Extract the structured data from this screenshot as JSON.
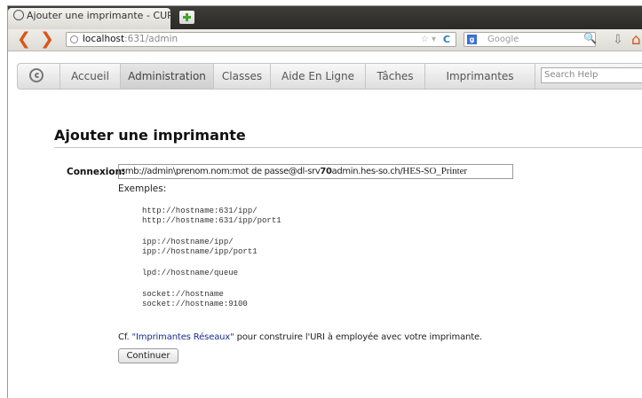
{
  "browser": {
    "tab_title": "Ajouter une imprimante - CUP...",
    "url_host": "localhost",
    "url_rest": ":631/admin",
    "search_engine_placeholder": "Google",
    "icons": [
      "back-arrow-icon",
      "forward-arrow-icon",
      "globe-icon",
      "bookmark-star-icon",
      "reload-icon",
      "google-icon",
      "magnifier-icon",
      "download-icon",
      "home-icon",
      "new-tab-icon"
    ]
  },
  "cups_menu": {
    "items": [
      "Accueil",
      "Administration",
      "Classes",
      "Aide En Ligne",
      "Tâches",
      "Imprimantes"
    ],
    "active": "Administration",
    "search_placeholder": "Search Help"
  },
  "page": {
    "title": "Ajouter une imprimante",
    "connection_label": "Connexion:",
    "connection_value_part1": "smb://admin\\prenom.nom:mot de passe@dl-srv",
    "connection_value_bold": "70",
    "connection_value_part2": "admin.hes-so.ch/",
    "connection_value_part3": "HES-SO_Printer",
    "examples_label": "Exemples:",
    "examples": [
      "http://hostname:631/ipp/",
      "http://hostname:631/ipp/port1",
      "ipp://hostname/ipp/",
      "ipp://hostname/ipp/port1",
      "lpd://hostname/queue",
      "socket://hostname",
      "socket://hostname:9100"
    ],
    "cf_prefix": "Cf. ",
    "cf_link": "\"Imprimantes Réseaux\"",
    "cf_suffix": " pour construire l'URI à employée avec votre imprimante.",
    "continue_button": "Continuer"
  }
}
